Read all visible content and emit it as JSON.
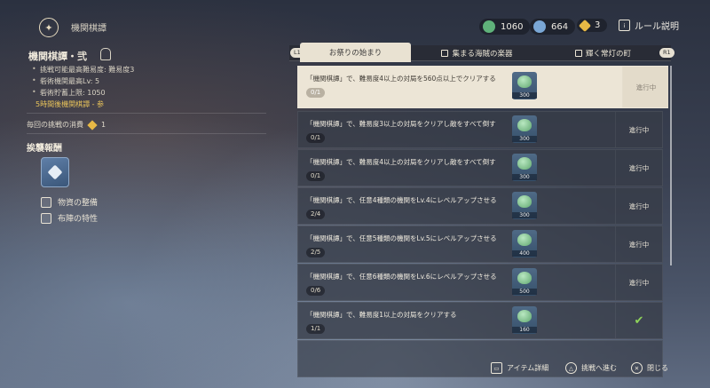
{
  "header": {
    "title": "機関棋譚",
    "currencies": [
      {
        "icon": "green-orb-icon",
        "value": "1060",
        "color": "#5fb27a"
      },
      {
        "icon": "blue-orb-icon",
        "value": "664",
        "color": "#7aa7d6"
      },
      {
        "icon": "gold-gem-icon",
        "value": "3",
        "color": "#e7b845"
      }
    ],
    "rules_label": "ルール説明"
  },
  "left": {
    "title": "機関棋譚・弐",
    "lines": [
      "挑戦可能最高難易度: 難易度3",
      "砦術機関最高Lv: 5",
      "砦術貯蓄上限: 1050"
    ],
    "notice": "5時間後機関棋譚 - 参",
    "cost_label": "毎回の挑戦の消費",
    "cost_value": "1",
    "section": "挨襲報酬",
    "links": [
      "物資の整備",
      "布陣の特性"
    ]
  },
  "tabs": [
    {
      "label": "お祭りの始まり",
      "key_hint": "L1"
    },
    {
      "label": "集まる海賊の楽器"
    },
    {
      "label": "輝く常灯の町",
      "key_hint": "R1"
    }
  ],
  "quests": [
    {
      "text": "「機関棋譚」で、難易度4以上の対局を560点以上でクリアする",
      "progress": "0/1",
      "reward": "300",
      "status": "進行中"
    },
    {
      "text": "「機関棋譚」で、難易度3以上の対局をクリアし敵をすべて倒す",
      "progress": "0/1",
      "reward": "300",
      "status": "進行中"
    },
    {
      "text": "「機関棋譚」で、難易度4以上の対局をクリアし敵をすべて倒す",
      "progress": "0/1",
      "reward": "300",
      "status": "進行中"
    },
    {
      "text": "「機関棋譚」で、任意4種類の機関をLv.4にレベルアップさせる",
      "progress": "2/4",
      "reward": "300",
      "status": "進行中"
    },
    {
      "text": "「機関棋譚」で、任意5種類の機関をLv.5にレベルアップさせる",
      "progress": "2/5",
      "reward": "400",
      "status": "進行中"
    },
    {
      "text": "「機関棋譚」で、任意6種類の機関をLv.6にレベルアップさせる",
      "progress": "0/6",
      "reward": "500",
      "status": "進行中"
    },
    {
      "text": "「機関棋譚」で、難易度1以上の対局をクリアする",
      "progress": "1/1",
      "reward": "160",
      "status": ""
    }
  ],
  "footer": {
    "item_detail": "アイテム詳細",
    "next": "挑戦へ進む",
    "close": "閉じる"
  }
}
